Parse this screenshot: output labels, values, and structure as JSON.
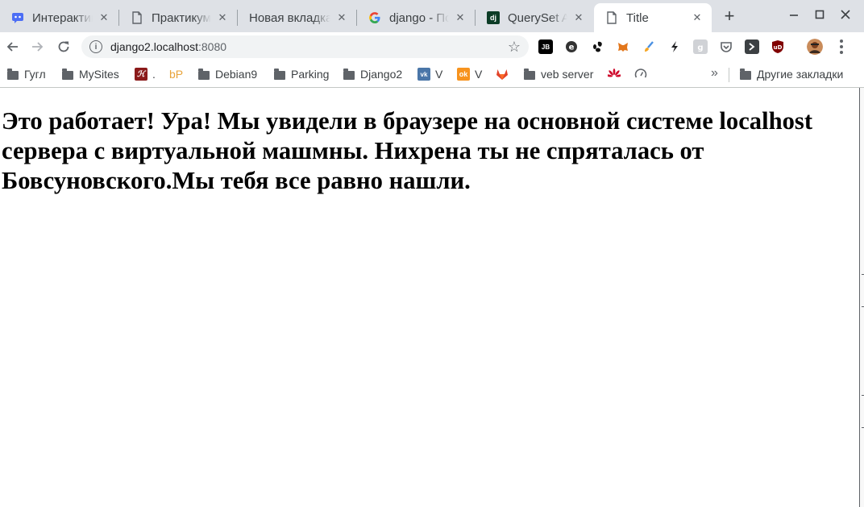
{
  "colors": {
    "tabstrip": "#dee1e6",
    "active_tab": "#ffffff",
    "omnibox": "#f1f3f4",
    "text": "#3c4043"
  },
  "tabs": [
    {
      "title": "Интерактивная",
      "icon": "assistant-icon",
      "active": false
    },
    {
      "title": "Практикум по",
      "icon": "document-icon",
      "active": false
    },
    {
      "title": "Новая вкладка",
      "icon": "",
      "active": false
    },
    {
      "title": "django - Поиск в",
      "icon": "google-icon",
      "active": false
    },
    {
      "title": "QuerySet API",
      "icon": "django-icon",
      "active": false
    },
    {
      "title": "Title",
      "icon": "document-icon",
      "active": true
    }
  ],
  "toolbar": {
    "url_host": "django2.localhost",
    "url_port": ":8080",
    "extensions": [
      "jetbrains-icon",
      "ghostery-icon",
      "gnome-icon",
      "metamask-icon",
      "brush-icon",
      "lightning-icon",
      "grey-extension-icon",
      "pocket-icon",
      "terminal-icon",
      "ublock-icon",
      "avatar-icon"
    ],
    "jb_label": "JB",
    "ub_label": "uD"
  },
  "bookmarks": [
    {
      "label": "Гугл",
      "icon": "folder-icon"
    },
    {
      "label": "MySites",
      "icon": "folder-icon"
    },
    {
      "label": ".",
      "icon": "site-icon"
    },
    {
      "label": "bP",
      "icon": ""
    },
    {
      "label": "Debian9",
      "icon": "folder-icon"
    },
    {
      "label": "Parking",
      "icon": "folder-icon"
    },
    {
      "label": "Django2",
      "icon": "folder-icon"
    },
    {
      "label": "V",
      "icon": "vk-icon"
    },
    {
      "label": "V",
      "icon": "odnoklassniki-icon"
    },
    {
      "label": "",
      "icon": "gitlab-icon"
    },
    {
      "label": "veb server",
      "icon": "folder-icon"
    },
    {
      "label": "",
      "icon": "huawei-icon"
    },
    {
      "label": "",
      "icon": "speedometer-icon"
    }
  ],
  "other_bookmarks": "Другие закладки",
  "page": {
    "heading": "Это работает! Ура! Мы увидели в браузере на основной системе localhost сервера с виртуальной машмны. Нихрена ты не спряталась от Бовсуновского.Мы тебя все равно нашли."
  }
}
